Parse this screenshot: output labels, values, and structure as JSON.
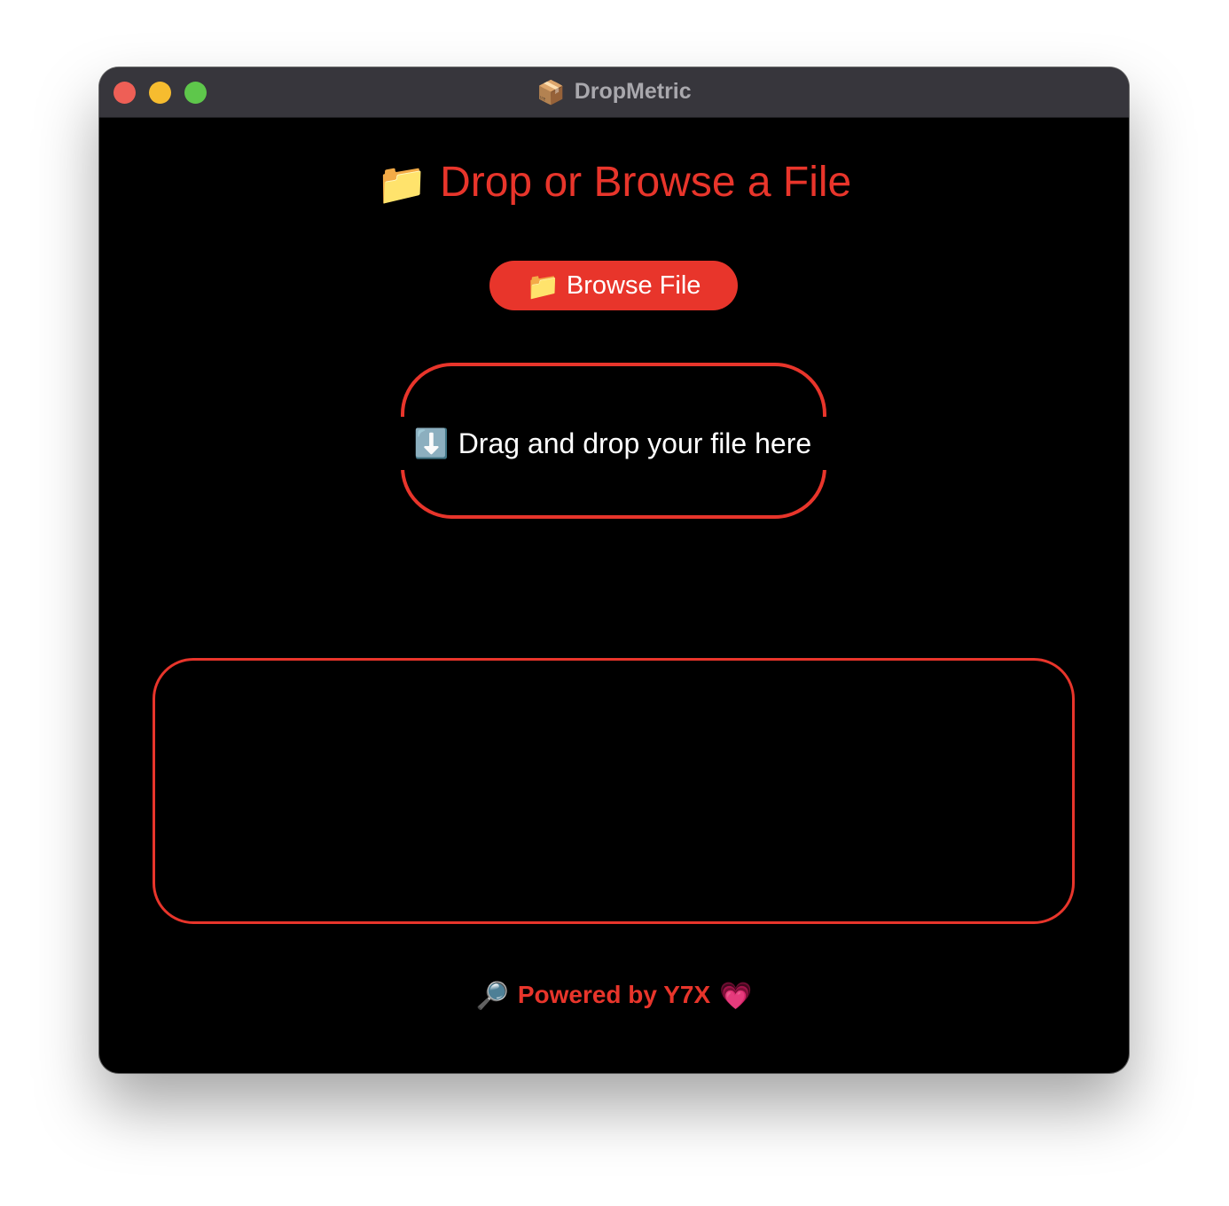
{
  "window": {
    "title": "DropMetric",
    "title_icon": "package-icon",
    "title_glyph": "📦"
  },
  "colors": {
    "accent": "#e8352b",
    "titlebar": "#37363c",
    "background": "#000000",
    "close": "#ee5f56",
    "minimize": "#f6bc2f",
    "maximize": "#5ec74b"
  },
  "heading": {
    "icon": "folder-icon",
    "glyph": "📁",
    "text": "Drop or Browse a File"
  },
  "browse_button": {
    "icon": "folder-icon",
    "glyph": "📁",
    "label": "Browse File"
  },
  "drop_zone": {
    "icon": "down-arrow-icon",
    "glyph": "⬇️",
    "label": "Drag and drop your file here"
  },
  "footer": {
    "left_icon": "magnifier-icon",
    "left_glyph": "🔎",
    "text": "Powered by Y7X",
    "right_icon": "heart-icon",
    "right_glyph": "💗"
  }
}
